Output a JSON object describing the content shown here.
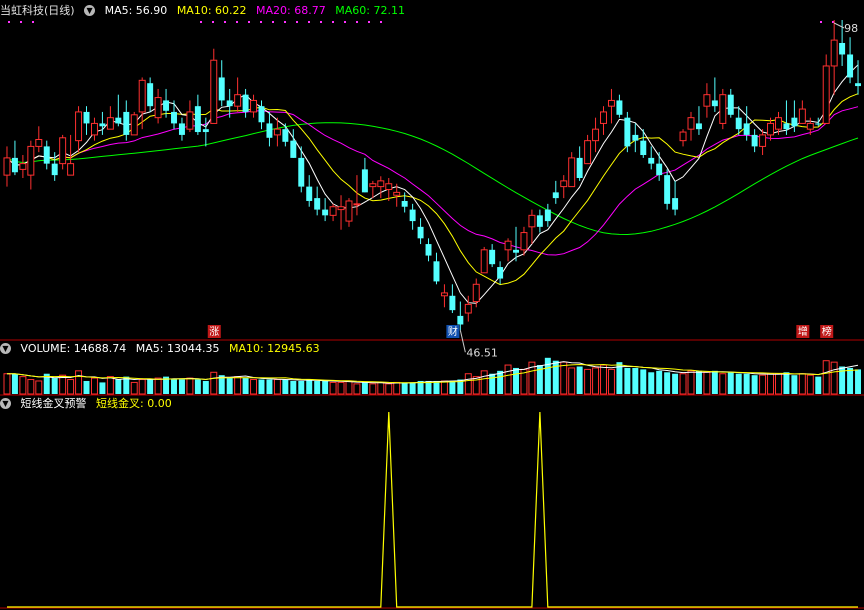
{
  "title": "当虹科技(日线)",
  "main_legend": [
    {
      "label": "MA5: 56.90",
      "color": "#ffffff"
    },
    {
      "label": "MA10: 60.22",
      "color": "#ffff00"
    },
    {
      "label": "MA20: 68.77",
      "color": "#ff00ff"
    },
    {
      "label": "MA60: 72.11",
      "color": "#00ff00"
    }
  ],
  "volume_legend": [
    {
      "label": "VOLUME: 14688.74",
      "color": "#ffffff"
    },
    {
      "label": "MA5: 13044.35",
      "color": "#ffffff"
    },
    {
      "label": "MA10: 12945.63",
      "color": "#ffff00"
    }
  ],
  "signal_legend": [
    {
      "label": "短线金叉预警",
      "color": "#ffffff"
    },
    {
      "label": "短线金叉: 0.00",
      "color": "#ffff00"
    }
  ],
  "annotations": {
    "low_label": "46.51",
    "high_label": "98"
  },
  "badges": [
    {
      "text": "涨",
      "bg": "#c01818",
      "candle": 26
    },
    {
      "text": "财",
      "bg": "#1050b0",
      "candle": 56
    },
    {
      "text": "增",
      "bg": "#c01818",
      "candle": 100
    },
    {
      "text": "榜",
      "bg": "#c01818",
      "candle": 103
    }
  ],
  "colors": {
    "up": "#ff3030",
    "down": "#54ffff",
    "ma5": "#ffffff",
    "ma10": "#ffff00",
    "ma20": "#ff00ff",
    "ma60": "#00ff00",
    "grid": "#b00000",
    "signal": "#ffff00"
  },
  "chart_data": {
    "type": "candlestick",
    "price_range": [
      44,
      99
    ],
    "ohlc": [
      [
        72,
        77,
        70,
        75
      ],
      [
        75,
        78,
        72,
        72.5
      ],
      [
        73,
        75.5,
        71.5,
        74
      ],
      [
        72,
        78,
        69.5,
        77
      ],
      [
        77,
        80.5,
        76,
        78.2
      ],
      [
        77,
        78,
        73,
        74
      ],
      [
        74,
        76,
        71,
        72
      ],
      [
        74,
        79,
        73,
        78.5
      ],
      [
        72,
        79,
        72,
        74
      ],
      [
        78,
        84,
        76,
        83
      ],
      [
        83,
        84,
        79,
        81
      ],
      [
        79,
        82,
        78,
        81
      ],
      [
        81,
        83,
        79,
        80.5
      ],
      [
        80,
        84,
        80,
        82
      ],
      [
        82,
        86,
        80.5,
        81
      ],
      [
        83,
        85,
        78,
        79
      ],
      [
        79,
        83,
        79,
        82.5
      ],
      [
        83,
        89,
        80,
        88.5
      ],
      [
        88,
        89,
        83,
        84
      ],
      [
        82,
        87,
        81,
        85.5
      ],
      [
        85,
        87,
        82,
        83.2
      ],
      [
        83,
        85,
        80,
        81
      ],
      [
        81,
        82,
        78,
        79
      ],
      [
        80,
        85,
        79.5,
        83
      ],
      [
        84,
        86,
        79,
        79.5
      ],
      [
        80,
        82,
        77,
        79.5
      ],
      [
        81,
        94,
        81,
        92
      ],
      [
        89,
        92,
        84,
        85
      ],
      [
        85,
        87,
        82,
        84
      ],
      [
        84,
        89,
        83,
        86
      ],
      [
        86,
        87,
        82,
        83
      ],
      [
        83,
        86,
        82,
        85
      ],
      [
        84,
        85,
        80,
        81.2
      ],
      [
        81,
        83,
        77,
        78.5
      ],
      [
        79,
        82,
        77,
        80
      ],
      [
        80,
        81,
        77,
        77.8
      ],
      [
        78,
        80,
        75,
        75
      ],
      [
        75,
        77,
        69,
        70
      ],
      [
        70,
        72,
        66.5,
        67.5
      ],
      [
        68,
        70,
        65,
        66
      ],
      [
        66,
        68,
        64,
        65
      ],
      [
        65,
        67,
        64,
        66.5
      ],
      [
        66,
        68.5,
        62.5,
        66.5
      ],
      [
        64,
        68,
        63,
        67.5
      ],
      [
        67,
        72,
        65,
        67
      ],
      [
        73,
        75,
        69,
        69
      ],
      [
        70,
        71,
        68,
        70.5
      ],
      [
        70,
        71.8,
        68,
        71
      ],
      [
        69.5,
        71.5,
        67.5,
        70.5
      ],
      [
        68.5,
        70.5,
        66.5,
        69
      ],
      [
        67.5,
        69,
        65.5,
        66.5
      ],
      [
        66,
        67,
        62.5,
        64
      ],
      [
        63,
        64.5,
        60,
        61
      ],
      [
        60,
        61,
        57,
        58
      ],
      [
        57,
        58.5,
        53,
        53.5
      ],
      [
        51,
        53,
        49,
        51.5
      ],
      [
        51,
        53,
        48,
        48.5
      ],
      [
        47.5,
        50,
        45,
        46
      ],
      [
        48,
        51,
        46.51,
        49.5
      ],
      [
        50,
        54,
        49,
        53
      ],
      [
        55,
        59.5,
        55,
        59
      ],
      [
        59,
        60,
        56,
        56.5
      ],
      [
        56,
        57,
        53,
        54
      ],
      [
        59,
        61,
        57,
        60.5
      ],
      [
        59,
        63,
        57,
        58.5
      ],
      [
        59,
        63,
        58,
        62
      ],
      [
        63,
        66,
        60,
        65
      ],
      [
        65,
        66,
        62,
        63
      ],
      [
        66,
        67,
        63,
        64
      ],
      [
        69,
        71,
        67,
        68
      ],
      [
        70,
        72,
        68,
        71
      ],
      [
        70,
        76,
        70,
        75
      ],
      [
        75,
        77,
        71,
        71.5
      ],
      [
        74,
        79,
        74,
        78
      ],
      [
        78,
        82,
        76,
        80
      ],
      [
        81,
        84,
        79,
        83
      ],
      [
        84,
        87,
        81,
        85
      ],
      [
        85,
        86,
        82,
        82.5
      ],
      [
        82,
        83,
        76,
        77
      ],
      [
        79,
        81,
        76,
        78
      ],
      [
        78,
        80,
        75,
        75.5
      ],
      [
        75,
        77,
        73,
        74
      ],
      [
        74,
        76,
        71,
        72
      ],
      [
        72,
        73,
        66,
        67
      ],
      [
        68,
        71,
        65,
        66
      ],
      [
        78,
        80,
        77,
        79.5
      ],
      [
        80,
        83,
        78,
        82
      ],
      [
        81,
        84,
        79,
        80
      ],
      [
        84,
        88,
        82,
        86
      ],
      [
        85,
        89,
        83,
        84
      ],
      [
        81,
        87,
        80,
        86
      ],
      [
        86,
        87,
        82,
        82.5
      ],
      [
        82,
        84,
        79,
        80
      ],
      [
        81,
        84,
        78,
        79
      ],
      [
        79,
        80,
        76,
        77
      ],
      [
        77,
        80,
        75.5,
        79
      ],
      [
        79,
        82,
        78,
        81
      ],
      [
        80,
        83,
        79,
        82
      ],
      [
        81,
        85,
        79,
        80
      ],
      [
        82,
        85,
        79.5,
        80.5
      ],
      [
        81,
        85,
        81,
        83.5
      ],
      [
        80,
        82,
        79,
        81
      ],
      [
        81,
        82,
        80.5,
        80.8
      ],
      [
        81,
        93,
        81,
        91
      ],
      [
        91,
        99,
        86,
        95.5
      ],
      [
        95,
        99,
        91,
        93
      ],
      [
        93,
        96,
        88,
        89
      ],
      [
        88,
        92,
        86,
        87.5
      ]
    ],
    "volume": [
      14,
      14,
      12,
      10,
      9,
      14,
      11,
      13,
      10,
      16,
      9,
      11,
      8,
      12,
      10,
      12,
      8,
      10,
      10,
      11,
      12,
      10,
      10,
      11,
      10,
      9,
      15,
      13,
      11,
      12,
      11,
      10,
      10,
      10,
      10,
      10,
      9,
      9,
      10,
      9,
      9,
      8,
      8,
      9,
      7,
      8,
      7,
      8,
      7,
      8,
      8,
      8,
      9,
      9,
      9,
      9,
      9,
      10,
      14,
      12,
      16,
      14,
      16,
      20,
      18,
      17,
      22,
      20,
      25,
      23,
      22,
      18,
      19,
      17,
      18,
      20,
      17,
      22,
      18,
      18,
      17,
      15,
      16,
      15,
      14,
      14,
      16,
      16,
      15,
      16,
      14,
      15,
      14,
      14,
      13,
      13,
      14,
      14,
      15,
      13,
      14,
      13,
      12,
      23,
      22,
      19,
      18,
      17
    ],
    "signal_spikes": [
      {
        "candle": 48,
        "value": 1
      },
      {
        "candle": 67,
        "value": 1
      }
    ],
    "signal_range": [
      0,
      1
    ]
  }
}
